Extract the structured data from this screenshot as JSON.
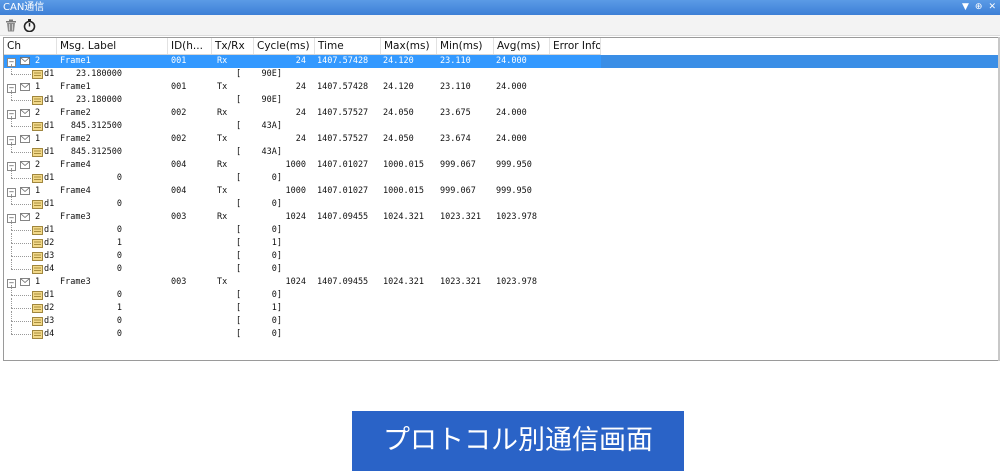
{
  "window": {
    "title": "CAN通信"
  },
  "title_controls": [
    "▼",
    "⊕",
    "✕"
  ],
  "toolbar": {
    "buttons": [
      "trash-icon",
      "stopwatch-icon"
    ]
  },
  "columns": [
    "Ch",
    "Msg. Label",
    "ID(h...",
    "Tx/Rx",
    "Cycle(ms)",
    "Time",
    "Max(ms)",
    "Min(ms)",
    "Avg(ms)",
    "Error Info"
  ],
  "rows": [
    {
      "kind": "msg",
      "ch": "2",
      "label": "Frame1",
      "id": "001",
      "txrx": "Rx",
      "cycle": "24",
      "time": "1407.57428",
      "max": "24.120",
      "min": "23.110",
      "avg": "24.000",
      "selected": true
    },
    {
      "kind": "data",
      "name": "d1",
      "value": "23.180000",
      "raw": "[    90E]"
    },
    {
      "kind": "msg",
      "ch": "1",
      "label": "Frame1",
      "id": "001",
      "txrx": "Tx",
      "cycle": "24",
      "time": "1407.57428",
      "max": "24.120",
      "min": "23.110",
      "avg": "24.000"
    },
    {
      "kind": "data",
      "name": "d1",
      "value": "23.180000",
      "raw": "[    90E]"
    },
    {
      "kind": "msg",
      "ch": "2",
      "label": "Frame2",
      "id": "002",
      "txrx": "Rx",
      "cycle": "24",
      "time": "1407.57527",
      "max": "24.050",
      "min": "23.675",
      "avg": "24.000"
    },
    {
      "kind": "data",
      "name": "d1",
      "value": "845.312500",
      "raw": "[    43A]"
    },
    {
      "kind": "msg",
      "ch": "1",
      "label": "Frame2",
      "id": "002",
      "txrx": "Tx",
      "cycle": "24",
      "time": "1407.57527",
      "max": "24.050",
      "min": "23.674",
      "avg": "24.000"
    },
    {
      "kind": "data",
      "name": "d1",
      "value": "845.312500",
      "raw": "[    43A]"
    },
    {
      "kind": "msg",
      "ch": "2",
      "label": "Frame4",
      "id": "004",
      "txrx": "Rx",
      "cycle": "1000",
      "time": "1407.01027",
      "max": "1000.015",
      "min": "999.067",
      "avg": "999.950"
    },
    {
      "kind": "data",
      "name": "d1",
      "value": "0",
      "raw": "[      0]"
    },
    {
      "kind": "msg",
      "ch": "1",
      "label": "Frame4",
      "id": "004",
      "txrx": "Tx",
      "cycle": "1000",
      "time": "1407.01027",
      "max": "1000.015",
      "min": "999.067",
      "avg": "999.950"
    },
    {
      "kind": "data",
      "name": "d1",
      "value": "0",
      "raw": "[      0]"
    },
    {
      "kind": "msg",
      "ch": "2",
      "label": "Frame3",
      "id": "003",
      "txrx": "Rx",
      "cycle": "1024",
      "time": "1407.09455",
      "max": "1024.321",
      "min": "1023.321",
      "avg": "1023.978"
    },
    {
      "kind": "data",
      "name": "d1",
      "value": "0",
      "raw": "[      0]"
    },
    {
      "kind": "data",
      "name": "d2",
      "value": "1",
      "raw": "[      1]"
    },
    {
      "kind": "data",
      "name": "d3",
      "value": "0",
      "raw": "[      0]"
    },
    {
      "kind": "data",
      "name": "d4",
      "value": "0",
      "raw": "[      0]"
    },
    {
      "kind": "msg",
      "ch": "1",
      "label": "Frame3",
      "id": "003",
      "txrx": "Tx",
      "cycle": "1024",
      "time": "1407.09455",
      "max": "1024.321",
      "min": "1023.321",
      "avg": "1023.978"
    },
    {
      "kind": "data",
      "name": "d1",
      "value": "0",
      "raw": "[      0]"
    },
    {
      "kind": "data",
      "name": "d2",
      "value": "1",
      "raw": "[      1]"
    },
    {
      "kind": "data",
      "name": "d3",
      "value": "0",
      "raw": "[      0]"
    },
    {
      "kind": "data",
      "name": "d4",
      "value": "0",
      "raw": "[      0]"
    }
  ],
  "caption": "プロトコル別通信画面",
  "colors": {
    "title_bar": "#3d7fd6",
    "selection": "#3399ff",
    "caption_bg": "#2a63c7"
  }
}
